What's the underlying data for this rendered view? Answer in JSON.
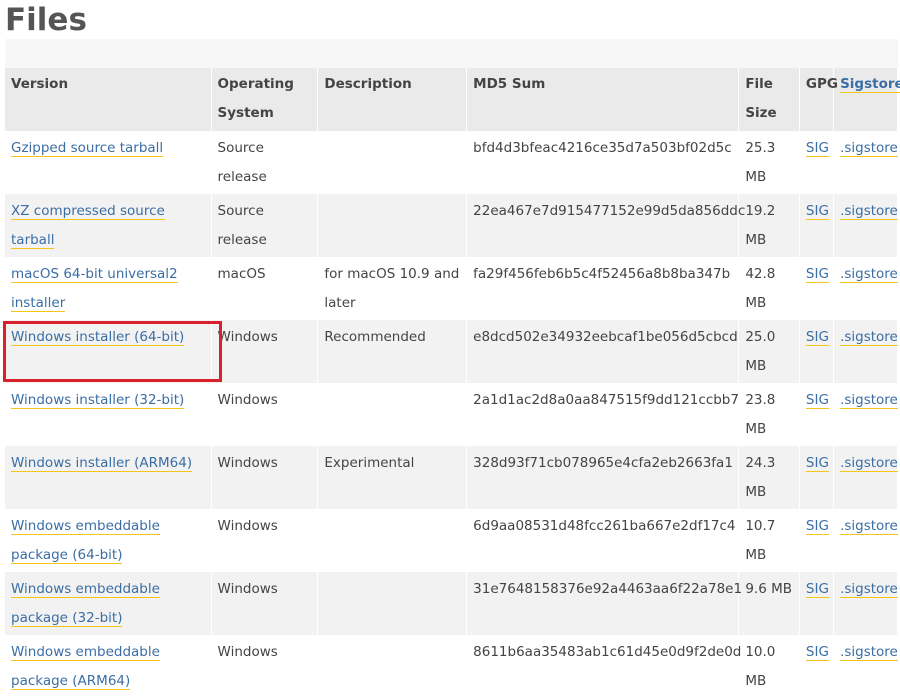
{
  "page": {
    "title": "Files"
  },
  "table": {
    "headers": {
      "version": "Version",
      "os": "Operating System",
      "description": "Description",
      "md5": "MD5 Sum",
      "size": "File Size",
      "gpg": "GPG",
      "sigstore": "Sigstore"
    },
    "rows": [
      {
        "version": "Gzipped source tarball",
        "os": "Source release",
        "description": "",
        "md5": "bfd4d3bfeac4216ce35d7a503bf02d5c",
        "size": "25.3 MB",
        "gpg": "SIG",
        "sigstore": ".sigstore"
      },
      {
        "version": "XZ compressed source tarball",
        "os": "Source release",
        "description": "",
        "md5": "22ea467e7d915477152e99d5da856ddc",
        "size": "19.2 MB",
        "gpg": "SIG",
        "sigstore": ".sigstore"
      },
      {
        "version": "macOS 64-bit universal2 installer",
        "os": "macOS",
        "description": "for macOS 10.9 and later",
        "md5": "fa29f456feb6b5c4f52456a8b8ba347b",
        "size": "42.8 MB",
        "gpg": "SIG",
        "sigstore": ".sigstore"
      },
      {
        "version": "Windows installer (64-bit)",
        "os": "Windows",
        "description": "Recommended",
        "md5": "e8dcd502e34932eebcaf1be056d5cbcd",
        "size": "25.0 MB",
        "gpg": "SIG",
        "sigstore": ".sigstore"
      },
      {
        "version": "Windows installer (32-bit)",
        "os": "Windows",
        "description": "",
        "md5": "2a1d1ac2d8a0aa847515f9dd121ccbb7",
        "size": "23.8 MB",
        "gpg": "SIG",
        "sigstore": ".sigstore"
      },
      {
        "version": "Windows installer (ARM64)",
        "os": "Windows",
        "description": "Experimental",
        "md5": "328d93f71cb078965e4cfa2eb2663fa1",
        "size": "24.3 MB",
        "gpg": "SIG",
        "sigstore": ".sigstore"
      },
      {
        "version": "Windows embeddable package (64-bit)",
        "os": "Windows",
        "description": "",
        "md5": "6d9aa08531d48fcc261ba667e2df17c4",
        "size": "10.7 MB",
        "gpg": "SIG",
        "sigstore": ".sigstore"
      },
      {
        "version": "Windows embeddable package (32-bit)",
        "os": "Windows",
        "description": "",
        "md5": "31e7648158376e92a4463aa6f22a78e1",
        "size": "9.6 MB",
        "gpg": "SIG",
        "sigstore": ".sigstore"
      },
      {
        "version": "Windows embeddable package (ARM64)",
        "os": "Windows",
        "description": "",
        "md5": "8611b6aa35483ab1c61d45e0d9f2de0d",
        "size": "10.0 MB",
        "gpg": "SIG",
        "sigstore": ".sigstore"
      }
    ]
  },
  "highlight": {
    "row_index": 3,
    "color": "#d9212b"
  },
  "colors": {
    "link": "#3a6ea5",
    "link_underline": "#f5c518",
    "header_bg": "#eaeaea"
  }
}
